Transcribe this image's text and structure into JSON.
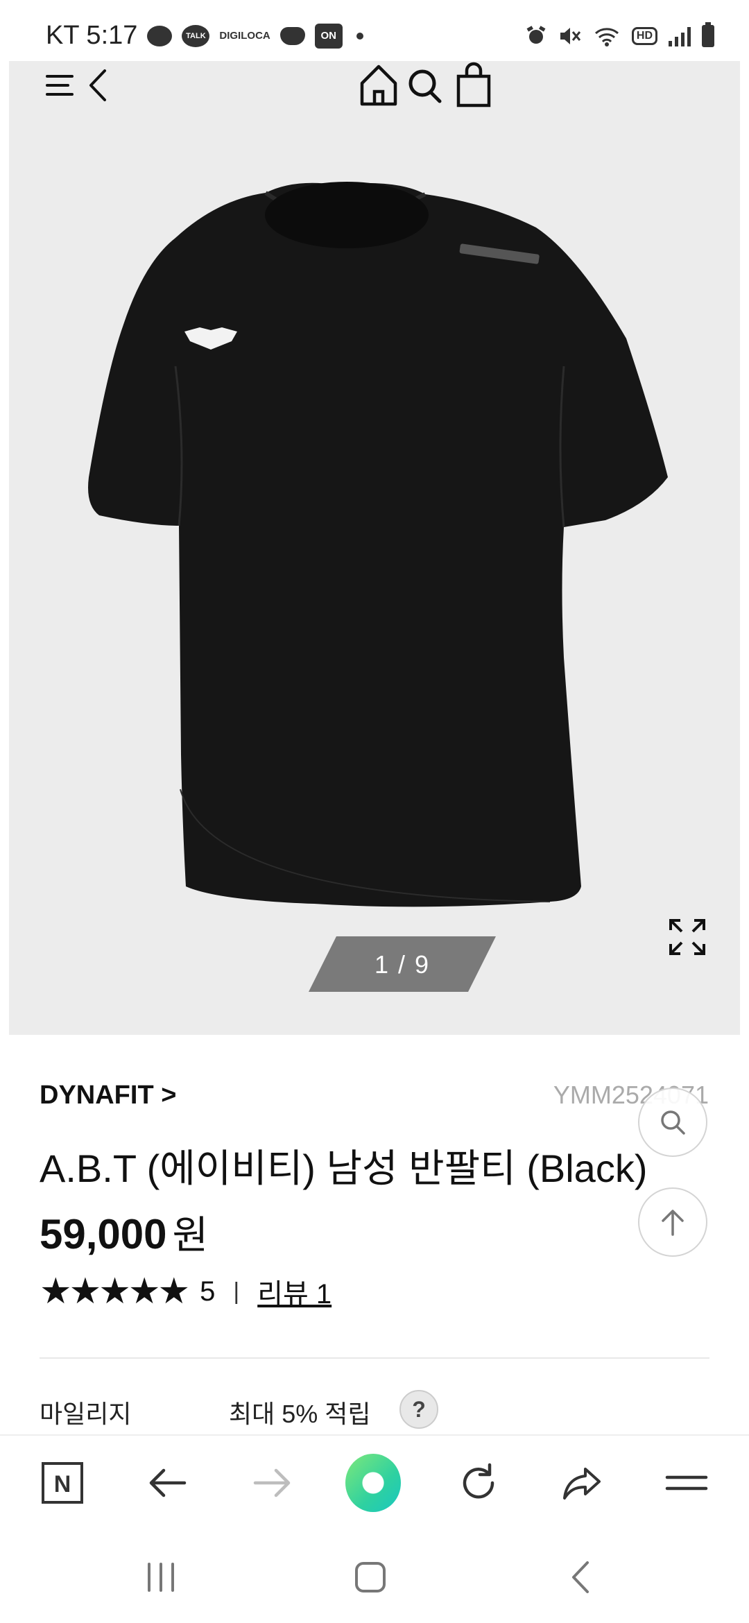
{
  "status_bar": {
    "carrier_time": "KT 5:17",
    "talk_label": "TALK",
    "digi_label_1": "DIGI",
    "digi_label_2": "LOCA",
    "on_label": "ON",
    "hd_label": "HD"
  },
  "header": {
    "menu_icon": "menu-icon",
    "back_icon": "chevron-left-icon",
    "home_icon": "home-icon",
    "search_icon": "search-icon",
    "bag_icon": "shopping-bag-icon"
  },
  "gallery": {
    "counter": "1 / 9",
    "expand_icon": "expand-icon"
  },
  "product": {
    "brand": "DYNAFIT >",
    "sku": "YMM2524071",
    "title": "A.B.T (에이비티) 남성 반팔티 (Black)",
    "price": "59,000",
    "currency": "원",
    "stars": "★★★★★",
    "rating": "5",
    "rating_sep": "|",
    "review_link": "리뷰 1",
    "mileage_label": "마일리지",
    "mileage_value": "최대 5% 적립",
    "mileage_help": "?"
  },
  "browser_toolbar": {
    "items": [
      "naver-n-icon",
      "back-arrow-icon",
      "forward-arrow-icon",
      "browser-home-icon",
      "refresh-icon",
      "share-icon",
      "menu-lines-icon"
    ],
    "naver_label": "N"
  },
  "colors": {
    "hero_bg": "#ececec",
    "counter_bg": "#7a7a7a",
    "accent_green": "#2fd1a0"
  }
}
